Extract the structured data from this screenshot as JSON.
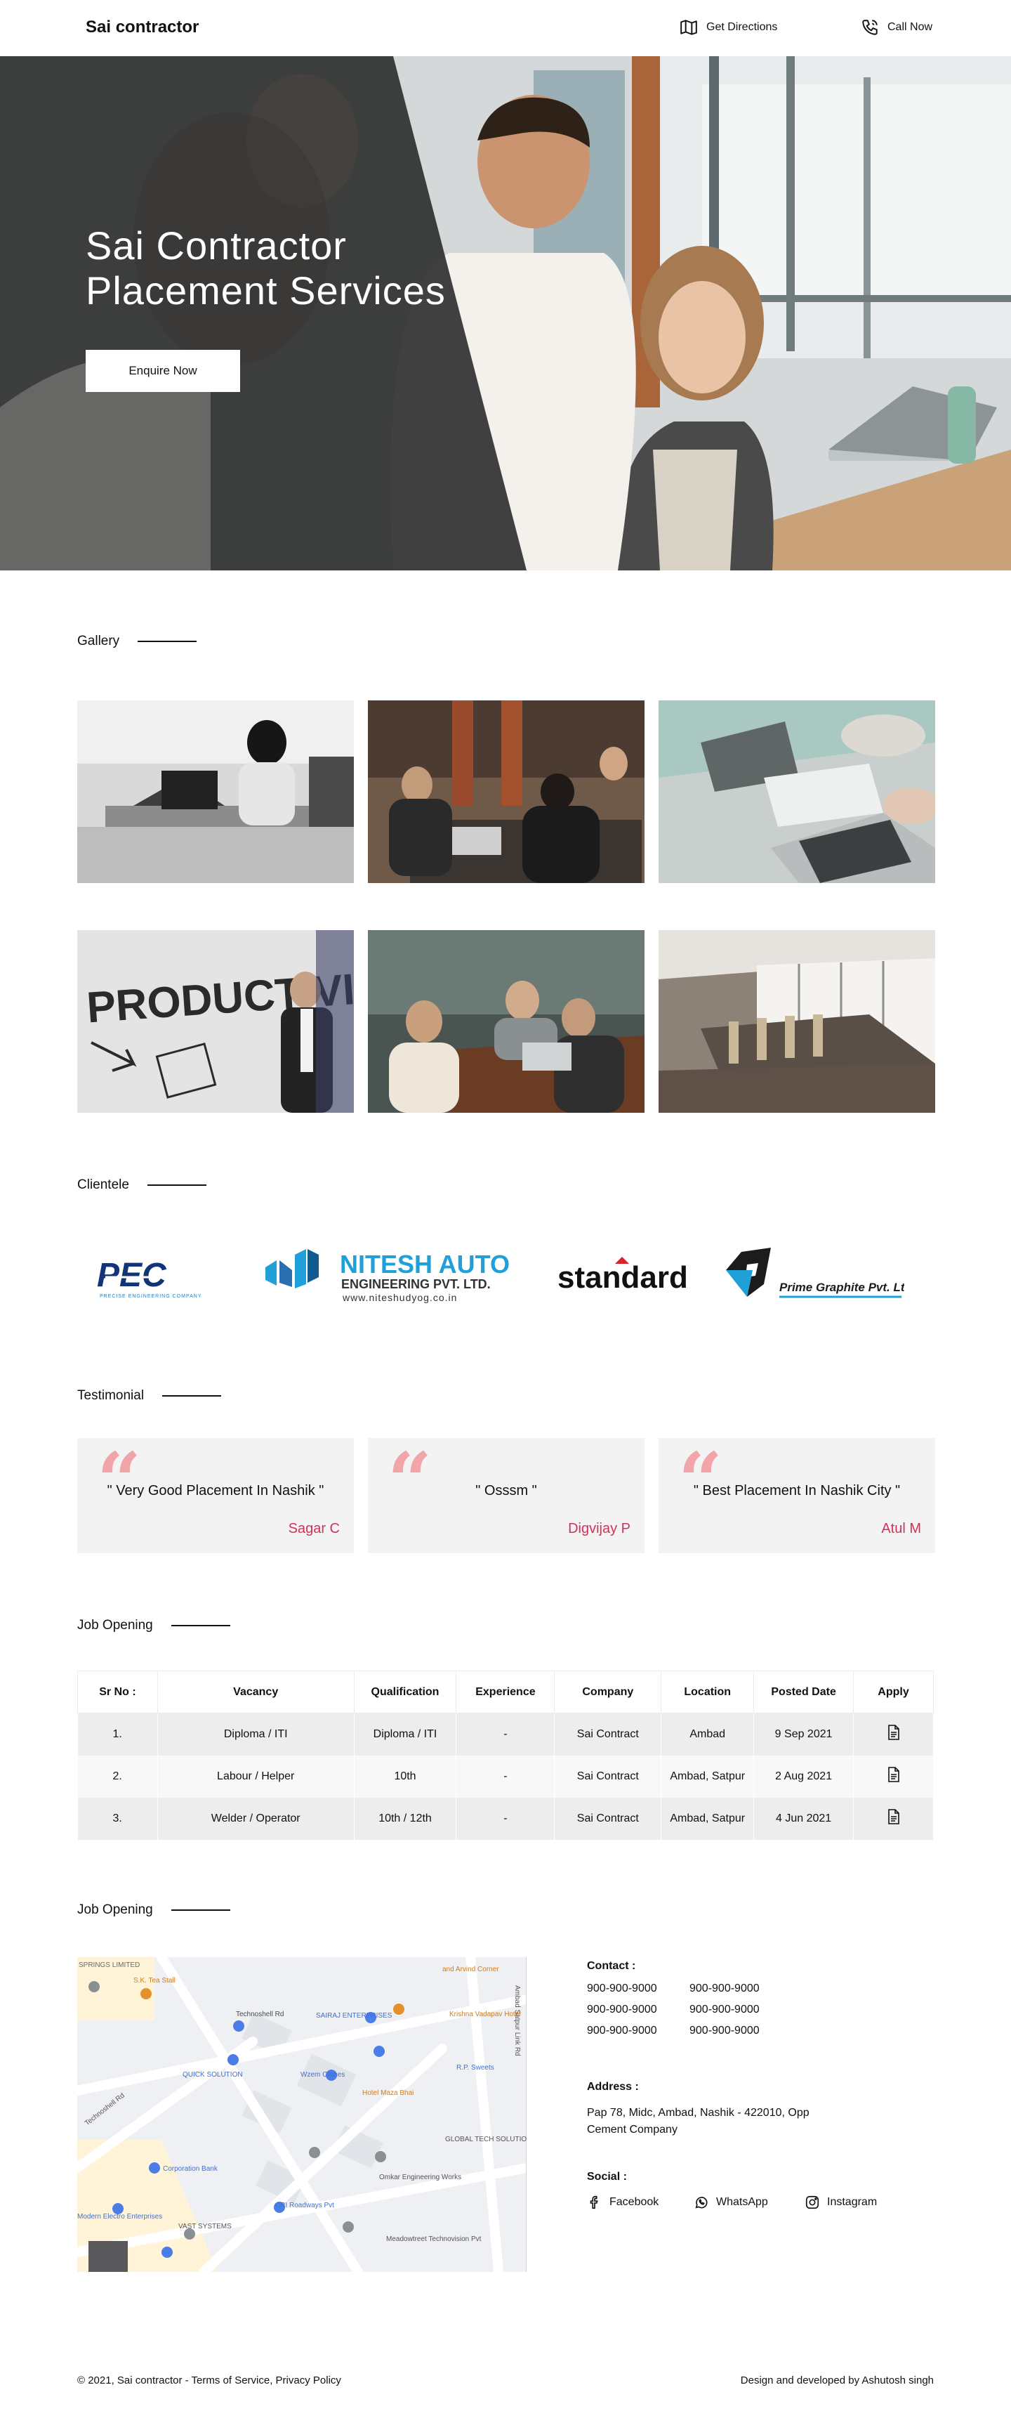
{
  "header": {
    "brand": "Sai contractor",
    "directions_label": "Get Directions",
    "call_label": "Call Now"
  },
  "hero": {
    "title": "Sai Contractor Placement Services",
    "cta_label": "Enquire Now"
  },
  "gallery": {
    "heading": "Gallery"
  },
  "clientele": {
    "heading": "Clientele",
    "logos": [
      {
        "name": "PEC",
        "tagline": "PRECISE ENGINEERING COMPANY"
      },
      {
        "name": "NITESH AUTO",
        "line2": "ENGINEERING PVT. LTD.",
        "line3": "www.niteshudyog.co.in"
      },
      {
        "name": "standard"
      },
      {
        "name": "Prime Graphite Pvt. Ltd."
      }
    ]
  },
  "testimonial": {
    "heading": "Testimonial",
    "items": [
      {
        "text": "\" Very Good Placement In Nashik \"",
        "author": "Sagar C"
      },
      {
        "text": "\" Osssm \"",
        "author": "Digvijay P"
      },
      {
        "text": "\" Best Placement In Nashik City \"",
        "author": "Atul M"
      }
    ],
    "accent_color": "#d2325a"
  },
  "jobs": {
    "heading": "Job Opening",
    "columns": [
      "Sr No :",
      "Vacancy",
      "Qualification",
      "Experience",
      "Company",
      "Location",
      "Posted Date",
      "Apply"
    ],
    "rows": [
      {
        "sr": "1.",
        "vacancy": "Diploma / ITI",
        "qualification": "Diploma / ITI",
        "experience": "-",
        "company": "Sai Contract",
        "location": "Ambad",
        "posted": "9 Sep 2021"
      },
      {
        "sr": "2.",
        "vacancy": "Labour / Helper",
        "qualification": "10th",
        "experience": "-",
        "company": "Sai Contract",
        "location": "Ambad, Satpur",
        "posted": "2 Aug 2021"
      },
      {
        "sr": "3.",
        "vacancy": "Welder / Operator",
        "qualification": "10th / 12th",
        "experience": "-",
        "company": "Sai Contract",
        "location": "Ambad, Satpur",
        "posted": "4 Jun 2021"
      }
    ]
  },
  "contact_section": {
    "heading": "Job Opening",
    "contact_label": "Contact :",
    "phones": [
      "900-900-9000",
      "900-900-9000",
      "900-900-9000",
      "900-900-9000",
      "900-900-9000",
      "900-900-9000"
    ],
    "address_label": "Address :",
    "address": "Pap 78, Midc, Ambad, Nashik - 422010, Opp Cement Company",
    "social_label": "Social :",
    "social": {
      "facebook": "Facebook",
      "whatsapp": "WhatsApp",
      "instagram": "Instagram"
    }
  },
  "map": {
    "labels": {
      "springs": "SPRINGS LIMITED",
      "tea_stall": "S.K. Tea Stall",
      "techno_rd": "Technoshell Rd",
      "sairaj": "SAIRAJ ENTERPRISES",
      "krishna": "Krishna Vadapav Hotel",
      "quick": "QUICK SOLUTION",
      "wzem": "Wzem Cranes",
      "maza": "Hotel Maza Bhai",
      "sweets": "R.P. Sweets",
      "global": "GLOBAL TECH SOLUTIONS",
      "omkar": "Omkar Engineering Works",
      "corp": "Corporation Bank",
      "cri": "CRI Roadways Pvt",
      "modern": "Modern Electro Enterprises",
      "vast": "VAST SYSTEMS",
      "meadow": "Meadowtreet Technovision Pvt",
      "link_rd": "Ambad Satpur Link Rd",
      "techno_rd2": "Technoshell Rd",
      "arvind": "and Arvind Corner"
    }
  },
  "footer": {
    "left": "© 2021, Sai contractor - Terms of Service, Privacy Policy",
    "right": "Design and developed by Ashutosh singh"
  }
}
